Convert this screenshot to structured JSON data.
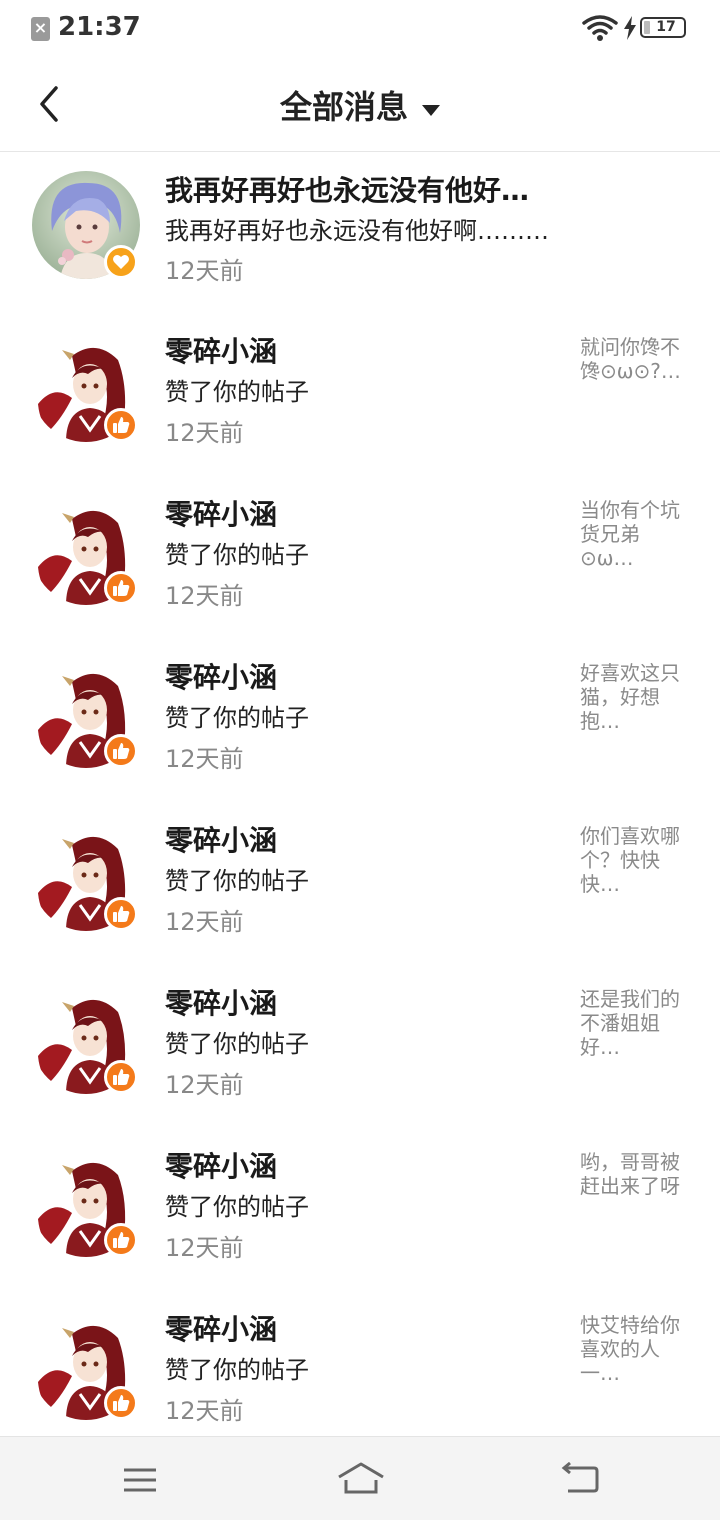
{
  "status_bar": {
    "time": "21:37",
    "battery": "17"
  },
  "header": {
    "title": "全部消息"
  },
  "messages": [
    {
      "name": "我再好再好也永远没有他好…",
      "text": "我再好再好也永远没有他好啊………",
      "time": "12天前",
      "badge": "heart-icon",
      "preview": ""
    },
    {
      "name": "零碎小涵",
      "text": "赞了你的帖子",
      "time": "12天前",
      "badge": "thumbs-up-icon",
      "preview": "就问你馋不馋⊙ω⊙?…"
    },
    {
      "name": "零碎小涵",
      "text": "赞了你的帖子",
      "time": "12天前",
      "badge": "thumbs-up-icon",
      "preview": "当你有个坑货兄弟⊙ω…"
    },
    {
      "name": "零碎小涵",
      "text": "赞了你的帖子",
      "time": "12天前",
      "badge": "thumbs-up-icon",
      "preview": "好喜欢这只猫，好想抱…"
    },
    {
      "name": "零碎小涵",
      "text": "赞了你的帖子",
      "time": "12天前",
      "badge": "thumbs-up-icon",
      "preview": "你们喜欢哪个？快快快…"
    },
    {
      "name": "零碎小涵",
      "text": "赞了你的帖子",
      "time": "12天前",
      "badge": "thumbs-up-icon",
      "preview": "还是我们的不潘姐姐好…"
    },
    {
      "name": "零碎小涵",
      "text": "赞了你的帖子",
      "time": "12天前",
      "badge": "thumbs-up-icon",
      "preview": "哟，哥哥被赶出来了呀"
    },
    {
      "name": "零碎小涵",
      "text": "赞了你的帖子",
      "time": "12天前",
      "badge": "thumbs-up-icon",
      "preview": "快艾特给你喜欢的人一…"
    }
  ],
  "colors": {
    "badge_orange": "#f47a1a",
    "badge_yellow": "#f7a21a",
    "time_gray": "#888888"
  }
}
